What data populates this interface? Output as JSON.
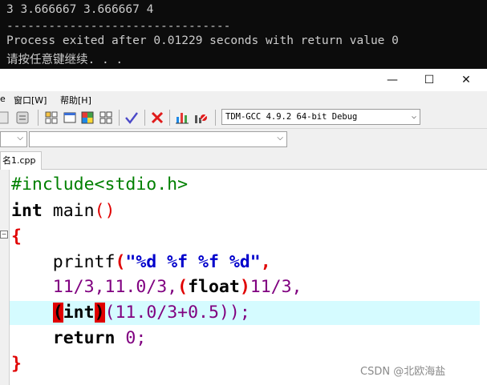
{
  "console": {
    "output_line": "3 3.666667 3.666667 4",
    "divider": "--------------------------------",
    "exit_message": "Process exited after 0.01229 seconds with return value 0",
    "press_key": "请按任意键继续. . ."
  },
  "window": {
    "minimize": "—",
    "maximize": "☐",
    "close": "✕"
  },
  "menu": {
    "partial": "e",
    "window": "窗口[W]",
    "help": "帮助[H]"
  },
  "toolbar": {
    "compiler": "TDM-GCC 4.9.2 64-bit Debug"
  },
  "tab": {
    "filename": "名1.cpp"
  },
  "code": {
    "line1": "#include<stdio.h>",
    "line2_kw": "int",
    "line2_rest": " main",
    "line2_parens": "()",
    "line3": "{",
    "line4_fn": "printf",
    "line4_paren": "(",
    "line4_str": "\"%d %f %f %d\"",
    "line4_comma": ",",
    "line5_a": "11/3,11.0/3,",
    "line5_paren_open": "(",
    "line5_kw": "float",
    "line5_paren_close": ")",
    "line5_b": "11/3,",
    "line6_paren_open": "(",
    "line6_kw": "int",
    "line6_paren_close": ")",
    "line6_expr_open": "(",
    "line6_expr": "11.0/3+0.5",
    "line6_expr_close": "))",
    "line6_semi": ";",
    "line7_kw": "return",
    "line7_num": " 0",
    "line7_semi": ";",
    "line8": "}"
  },
  "colors": {
    "console_bg": "#0c0c0c",
    "preprocessor": "#008000",
    "string": "#0000cc",
    "number": "#800080",
    "bracket": "#e00000",
    "highlight_line": "#d5fbff"
  },
  "watermark": "CSDN @北欧海盐"
}
